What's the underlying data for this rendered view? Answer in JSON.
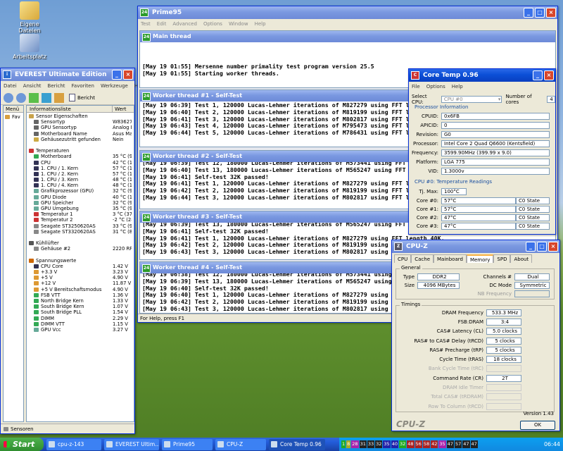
{
  "desktop": {
    "icons": [
      "Eigene Dateien",
      "Arbeitsplatz"
    ]
  },
  "everest": {
    "title": "EVEREST Ultimate Edition",
    "menu": [
      "Datei",
      "Ansicht",
      "Bericht",
      "Favoriten",
      "Werkzeuge",
      "Hilfe"
    ],
    "toolbar_report": "Bericht",
    "tab_menu": "Menü",
    "tab_fav": "Fav",
    "col_info": "Informationsliste",
    "col_value": "Wert",
    "status": "Sensoren",
    "rows": [
      {
        "n": "Sensor Eigenschaften",
        "v": "",
        "h": 1,
        "c": "#c8a24a"
      },
      {
        "n": "Sensortyp",
        "v": "W83627...",
        "c": "#666"
      },
      {
        "n": "GPU Sensortyp",
        "v": "Analog D...",
        "c": "#666"
      },
      {
        "n": "Motherboard Name",
        "v": "Asus Ma...",
        "c": "#666"
      },
      {
        "n": "Gehäusezutritt gefunden",
        "v": "Nein",
        "c": "#ca4"
      },
      {
        "n": "",
        "v": ""
      },
      {
        "n": "Temperaturen",
        "v": "",
        "h": 1,
        "c": "#c33"
      },
      {
        "n": "Motherboard",
        "v": "35 °C (9...",
        "c": "#3a5"
      },
      {
        "n": "CPU",
        "v": "42 °C (1...",
        "c": "#335"
      },
      {
        "n": "1. CPU / 1. Kern",
        "v": "57 °C (1...",
        "c": "#335"
      },
      {
        "n": "1. CPU / 2. Kern",
        "v": "57 °C (1...",
        "c": "#335"
      },
      {
        "n": "1. CPU / 3. Kern",
        "v": "48 °C (1...",
        "c": "#335"
      },
      {
        "n": "1. CPU / 4. Kern",
        "v": "48 °C (1...",
        "c": "#335"
      },
      {
        "n": "Grafikprozessor (GPU)",
        "v": "32 °C (9...",
        "c": "#6a9"
      },
      {
        "n": "GPU Diode",
        "v": "40 °C (1...",
        "c": "#6a9"
      },
      {
        "n": "GPU Speicher",
        "v": "32 °C (9...",
        "c": "#6a9"
      },
      {
        "n": "GPU Umgebung",
        "v": "35 °C (9...",
        "c": "#6a9"
      },
      {
        "n": "Temperatur 1",
        "v": "3 °C (37...",
        "c": "#c33"
      },
      {
        "n": "Temperatur 2",
        "v": "-2 °C (28...",
        "c": "#c33"
      },
      {
        "n": "Seagate ST3250620AS",
        "v": "33 °C (9...",
        "c": "#888"
      },
      {
        "n": "Seagate ST3320620AS",
        "v": "31 °C (8...",
        "c": "#888"
      },
      {
        "n": "",
        "v": ""
      },
      {
        "n": "Kühllüfter",
        "v": "",
        "h": 1,
        "c": "#555"
      },
      {
        "n": "Gehäuse #2",
        "v": "2220 RPM",
        "c": "#888"
      },
      {
        "n": "",
        "v": ""
      },
      {
        "n": "Spannungswerte",
        "v": "",
        "h": 1,
        "c": "#c60"
      },
      {
        "n": "CPU Core",
        "v": "1.42 V",
        "c": "#335"
      },
      {
        "n": "+3.3 V",
        "v": "3.23 V",
        "c": "#d93"
      },
      {
        "n": "+5 V",
        "v": "4.90 V",
        "c": "#d93"
      },
      {
        "n": "+12 V",
        "v": "11.87 V",
        "c": "#d93"
      },
      {
        "n": "+5 V Bereitschaftsmodus",
        "v": "4.90 V",
        "c": "#d93"
      },
      {
        "n": "FSB VTT",
        "v": "1.36 V",
        "c": "#3a5"
      },
      {
        "n": "North Bridge Kern",
        "v": "1.33 V",
        "c": "#3a5"
      },
      {
        "n": "South Bridge Kern",
        "v": "1.07 V",
        "c": "#3a5"
      },
      {
        "n": "South Bridge PLL",
        "v": "1.54 V",
        "c": "#3a5"
      },
      {
        "n": "DIMM",
        "v": "2.29 V",
        "c": "#3a5"
      },
      {
        "n": "DIMM VTT",
        "v": "1.15 V",
        "c": "#3a5"
      },
      {
        "n": "GPU Vcc",
        "v": "3.27 V",
        "c": "#6a9"
      }
    ]
  },
  "prime": {
    "title": "Prime95",
    "menu": [
      "Test",
      "Edit",
      "Advanced",
      "Options",
      "Window",
      "Help"
    ],
    "status": "For Help, press F1",
    "main_title": "Main thread",
    "main_log": "\n\n\n[May 19 01:55] Mersenne number primality test program version 25.5\n[May 19 01:55] Starting worker threads.",
    "workers": [
      {
        "title": "Worker thread #1 - Self-Test",
        "log": "[May 19 06:39] Test 1, 120000 Lucas-Lehmer iterations of M827279 using FFT length 40K.\n[May 19 06:40] Test 2, 120000 Lucas-Lehmer iterations of M819199 using FFT length 40K.\n[May 19 06:41] Test 3, 120000 Lucas-Lehmer iterations of M802817 using FFT length 40K.\n[May 19 06:43] Test 4, 120000 Lucas-Lehmer iterations of M795473 using FFT length 40K.\n[May 19 06:44] Test 5, 120000 Lucas-Lehmer iterations of M786431 using FFT length 40K."
      },
      {
        "title": "Worker thread #2 - Self-Test",
        "log": "[May 19 06:39] Test 12, 180000 Lucas-Lehmer iterations of M573441 using FFT length 32K.\n[May 19 06:40] Test 13, 180000 Lucas-Lehmer iterations of M565247 using FFT length 32K.\n[May 19 06:41] Self-test 32K passed!\n[May 19 06:41] Test 1, 120000 Lucas-Lehmer iterations of M827279 using FFT length 40K.\n[May 19 06:42] Test 2, 120000 Lucas-Lehmer iterations of M819199 using FFT length 40K.\n[May 19 06:44] Test 3, 120000 Lucas-Lehmer iterations of M802817 using FFT length 40K."
      },
      {
        "title": "Worker thread #3 - Self-Test",
        "log": "[May 19 06:39] Test 13, 180000 Lucas-Lehmer iterations of M565247 using FFT length 32K.\n[May 19 06:41] Self-test 32K passed!\n[May 19 06:41] Test 1, 120000 Lucas-Lehmer iterations of M827279 using FFT length 40K.\n[May 19 06:42] Test 2, 120000 Lucas-Lehmer iterations of M819199 using FFT length 40K.\n[May 19 06:43] Test 3, 120000 Lucas-Lehmer iterations of M802817 using FFT length 40K."
      },
      {
        "title": "Worker thread #4 - Self-Test",
        "log": "[May 19 06:38] Test 12, 180000 Lucas-Lehmer iterations of M573441 using FFT length 32K.\n[May 19 06:39] Test 13, 180000 Lucas-Lehmer iterations of M565247 using FFT length 32K.\n[May 19 06:40] Self-test 32K passed!\n[May 19 06:40] Test 1, 120000 Lucas-Lehmer iterations of M827279 using FFT length 40K.\n[May 19 06:42] Test 2, 120000 Lucas-Lehmer iterations of M819199 using FFT length 40K.\n[May 19 06:43] Test 3, 120000 Lucas-Lehmer iterations of M802817 using FFT length 40K."
      }
    ]
  },
  "coretemp": {
    "title": "Core Temp 0.96",
    "menu": [
      "File",
      "Options",
      "Help"
    ],
    "select_cpu_label": "Select CPU:",
    "select_cpu_value": "CPU #0",
    "cores_label": "Number of cores",
    "cores_value": "4",
    "proc_info": "Processor Information",
    "info": [
      {
        "k": "CPUID:",
        "v": "0x6FB"
      },
      {
        "k": "APICID:",
        "v": "0"
      },
      {
        "k": "Revision:",
        "v": "G0"
      },
      {
        "k": "Processor:",
        "v": "Intel Core 2 Quad Q6600 (Kentsfield)"
      },
      {
        "k": "Frequency:",
        "v": "3599.90MHz (399.99 x 9.0)"
      },
      {
        "k": "Platform:",
        "v": "LGA 775"
      },
      {
        "k": "VID:",
        "v": "1.3000v"
      }
    ],
    "temp_title": "CPU #0: Temperature Readings",
    "tjmax_label": "Tj. Max:",
    "tjmax": "100°C",
    "cores": [
      {
        "k": "Core #0:",
        "t": "57°C",
        "s": "C0 State"
      },
      {
        "k": "Core #1:",
        "t": "57°C",
        "s": "C0 State"
      },
      {
        "k": "Core #2:",
        "t": "47°C",
        "s": "C0 State"
      },
      {
        "k": "Core #3:",
        "t": "47°C",
        "s": "C0 State"
      }
    ]
  },
  "cpuz": {
    "title": "CPU-Z",
    "tabs": [
      "CPU",
      "Cache",
      "Mainboard",
      "Memory",
      "SPD",
      "About"
    ],
    "active_tab": "Memory",
    "general_title": "General",
    "type_label": "Type",
    "type": "DDR2",
    "size_label": "Size",
    "size": "4096 MBytes",
    "channels_label": "Channels #",
    "channels": "Dual",
    "dc_label": "DC Mode",
    "dc": "Symmetric",
    "nb_label": "NB Frequency",
    "nb": "",
    "timings_title": "Timings",
    "timings": [
      {
        "k": "DRAM Frequency",
        "v": "533.3 MHz",
        "d": 0
      },
      {
        "k": "FSB:DRAM",
        "v": "3:4",
        "d": 0
      },
      {
        "k": "CAS# Latency (CL)",
        "v": "5.0 clocks",
        "d": 0
      },
      {
        "k": "RAS# to CAS# Delay (tRCD)",
        "v": "5 clocks",
        "d": 0
      },
      {
        "k": "RAS# Precharge (tRP)",
        "v": "5 clocks",
        "d": 0
      },
      {
        "k": "Cycle Time (tRAS)",
        "v": "18 clocks",
        "d": 0
      },
      {
        "k": "Bank Cycle Time (tRC)",
        "v": "",
        "d": 1
      },
      {
        "k": "Command Rate (CR)",
        "v": "2T",
        "d": 0
      },
      {
        "k": "DRAM Idle Timer",
        "v": "",
        "d": 1
      },
      {
        "k": "Total CAS# (tRDRAM)",
        "v": "",
        "d": 1
      },
      {
        "k": "Row To Column (tRCD)",
        "v": "",
        "d": 1
      }
    ],
    "version": "Version 1.43",
    "brand": "CPU-Z",
    "ok": "OK"
  },
  "taskbar": {
    "start": "Start",
    "items": [
      "cpu-z-143",
      "EVEREST Ultim...",
      "Prime95",
      "CPU-Z",
      "Core Temp 0.96"
    ],
    "active": "Core Temp 0.96",
    "tray": [
      "1",
      "8",
      "28",
      "31",
      "33",
      "32",
      "35",
      "40",
      "32",
      "48",
      "56",
      "58",
      "42",
      "35",
      "47",
      "57",
      "47",
      "47"
    ],
    "clock": "06:44"
  }
}
